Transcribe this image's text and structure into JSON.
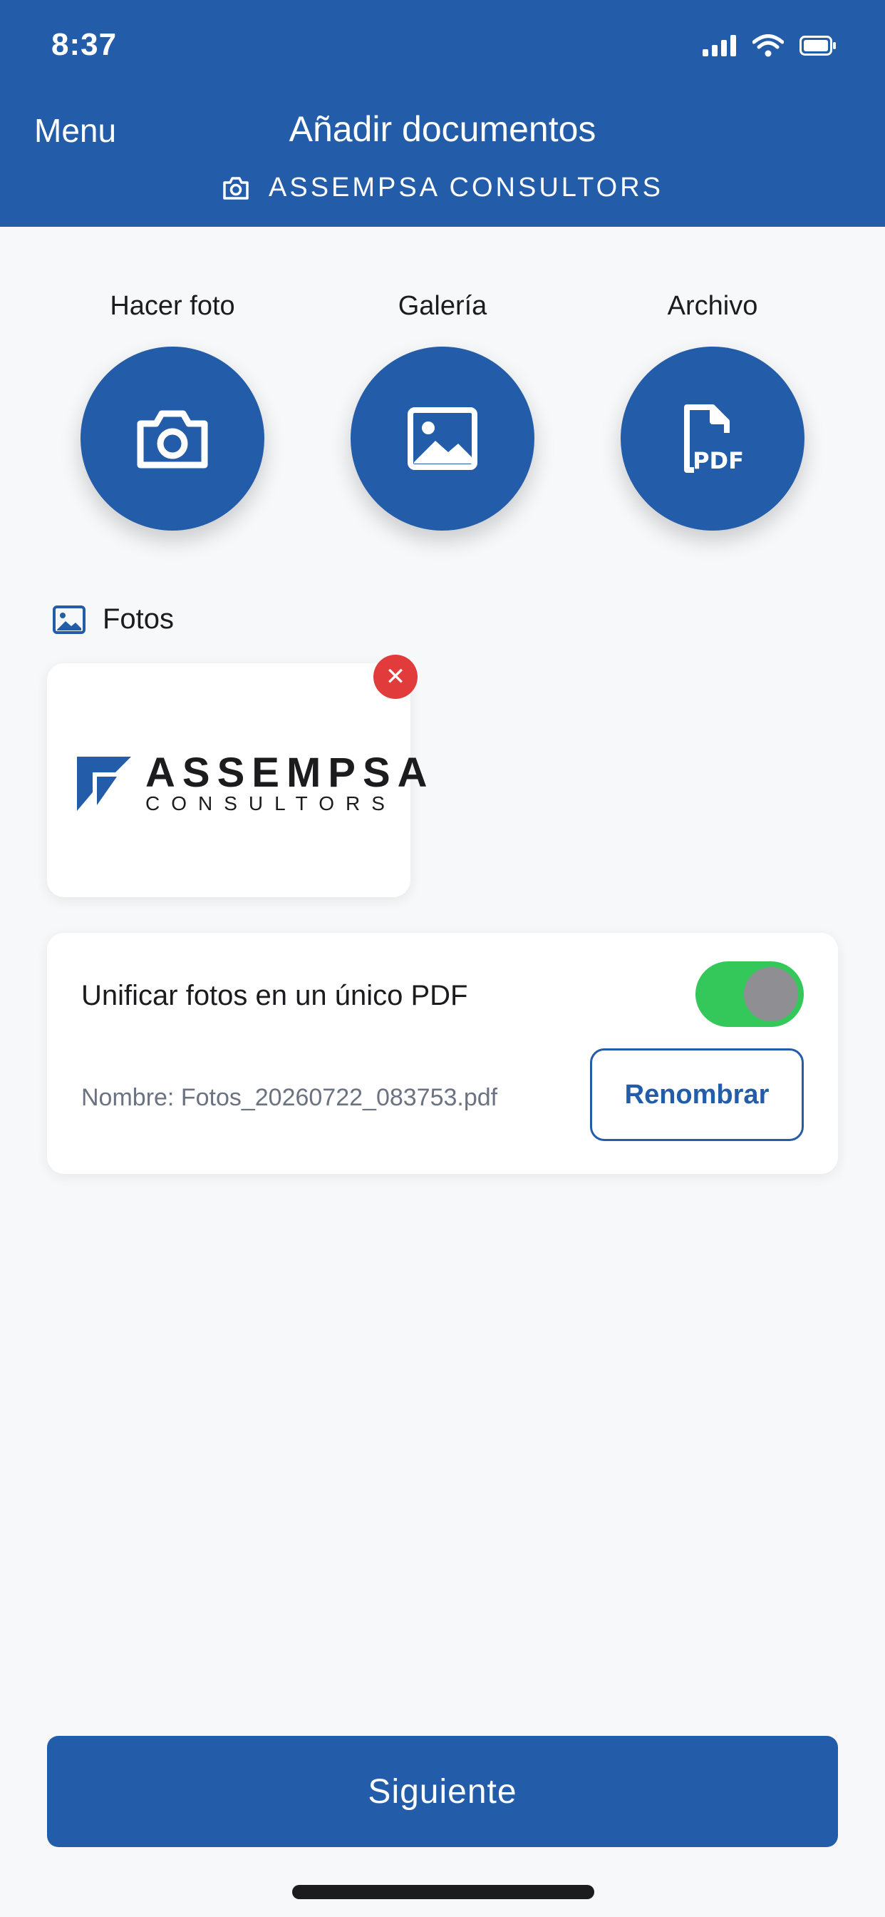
{
  "status_bar": {
    "time": "8:37"
  },
  "header": {
    "menu_label": "Menu",
    "title": "Añadir documentos",
    "subtitle": "ASSEMPSA CONSULTORS",
    "subtitle_icon": "camera-icon"
  },
  "actions": [
    {
      "label": "Hacer foto",
      "icon": "camera-icon"
    },
    {
      "label": "Galería",
      "icon": "image-icon"
    },
    {
      "label": "Archivo",
      "icon": "pdf-file-icon"
    }
  ],
  "photos": {
    "section_label": "Fotos",
    "items": [
      {
        "logo_main": "ASSEMPSA",
        "logo_sub": "CONSULTORS",
        "remove_icon": "close-icon"
      }
    ]
  },
  "options": {
    "unify_label": "Unificar fotos en un único PDF",
    "unify_enabled": true,
    "filename": "Nombre: Fotos_20260722_083753.pdf",
    "rename_label": "Renombrar"
  },
  "footer": {
    "next_label": "Siguiente"
  },
  "colors": {
    "primary": "#235ca8",
    "toggle_on": "#34c759",
    "danger": "#e23b3b",
    "background": "#f7f8fa"
  }
}
